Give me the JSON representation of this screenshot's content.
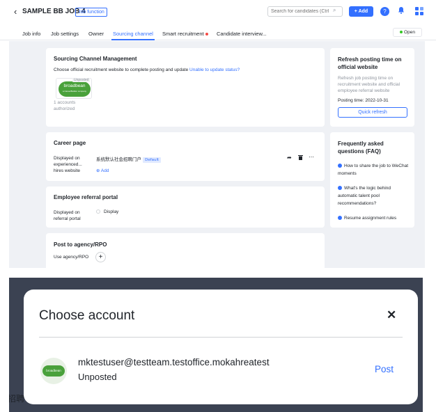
{
  "header": {
    "back_icon": "‹",
    "job_title": "SAMPLE BB JOB 4",
    "job_tag": "Job function",
    "search_placeholder": "Search for candidates (Ctrl",
    "add_label": "+ Add",
    "help_icon": "?",
    "bell_icon": "🔔"
  },
  "tabs": [
    {
      "label": "Job info"
    },
    {
      "label": "Job settings"
    },
    {
      "label": "Owner"
    },
    {
      "label": "Sourcing channel",
      "active": true
    },
    {
      "label": "Smart recruitment",
      "badge": true
    },
    {
      "label": "Candidate interview..."
    }
  ],
  "status": "Open",
  "sourcing": {
    "title": "Sourcing Channel Management",
    "desc": "Choose official recruitment website to complete posting and update",
    "link": "Unable to update status?",
    "logo_text": "broadbean",
    "logo_sub": "a CareerBuilder company",
    "unposted_tag": "Unposted",
    "accounts": "1 accounts",
    "authorized": "authorized"
  },
  "refresh": {
    "title": "Refresh posting time on official website",
    "desc": "Refresh job posting time on recruitment website and official employee referral website",
    "posting_time": "Posting time: 2022-10-31",
    "button": "Quick refresh"
  },
  "career": {
    "title": "Career page",
    "label": "Displayed on experienced... hires website",
    "site": "系统默认社会招聘门户",
    "default_tag": "Default",
    "add": "Add"
  },
  "faq": {
    "title": "Frequently asked questions (FAQ)",
    "items": [
      "How to share the job to WeChat moments",
      "What's the logic behind automatic talent pool recommendations?",
      "Resume assignment rules"
    ]
  },
  "referral": {
    "title": "Employee referral portal",
    "label": "Displayed on referral portal",
    "option": "Display"
  },
  "agency": {
    "title": "Post to agency/RPO",
    "label": "Use agency/RPO"
  },
  "modal": {
    "title": "Choose account",
    "close": "✕",
    "email": "mktestuser@testteam.testoffice.mokahreatest",
    "status": "Unposted",
    "post": "Post",
    "logo_text": "broadbean"
  },
  "behind_text": "招聘"
}
